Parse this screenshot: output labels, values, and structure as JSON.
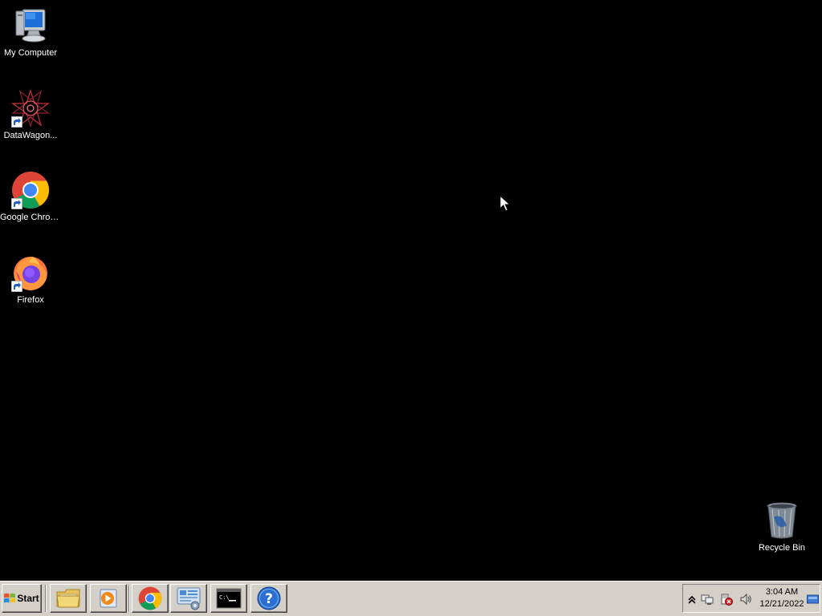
{
  "desktop": {
    "background": "#000000",
    "icons": [
      {
        "label": "My Computer",
        "icon": "my-computer-icon",
        "shortcut": false
      },
      {
        "label": "DataWagon...",
        "icon": "datawagon-icon",
        "shortcut": true
      },
      {
        "label": "Google Chrome",
        "icon": "chrome-icon",
        "shortcut": true
      },
      {
        "label": "Firefox",
        "icon": "firefox-icon",
        "shortcut": true
      },
      {
        "label": "Recycle Bin",
        "icon": "recycle-bin-icon",
        "shortcut": false
      }
    ]
  },
  "taskbar": {
    "start_label": "Start",
    "pinned": [
      {
        "name": "file-explorer",
        "icon": "folder-icon"
      },
      {
        "name": "media-player",
        "icon": "media-player-icon"
      },
      {
        "name": "google-chrome",
        "icon": "chrome-icon"
      },
      {
        "name": "server-manager",
        "icon": "server-manager-icon"
      },
      {
        "name": "command-prompt",
        "icon": "command-prompt-icon"
      },
      {
        "name": "help",
        "icon": "help-icon"
      }
    ],
    "tray": {
      "icons": [
        "show-hidden-icons-icon",
        "network-icon",
        "action-center-icon",
        "volume-icon",
        "show-desktop-icon"
      ],
      "time": "3:04 AM",
      "date": "12/21/2022"
    }
  }
}
